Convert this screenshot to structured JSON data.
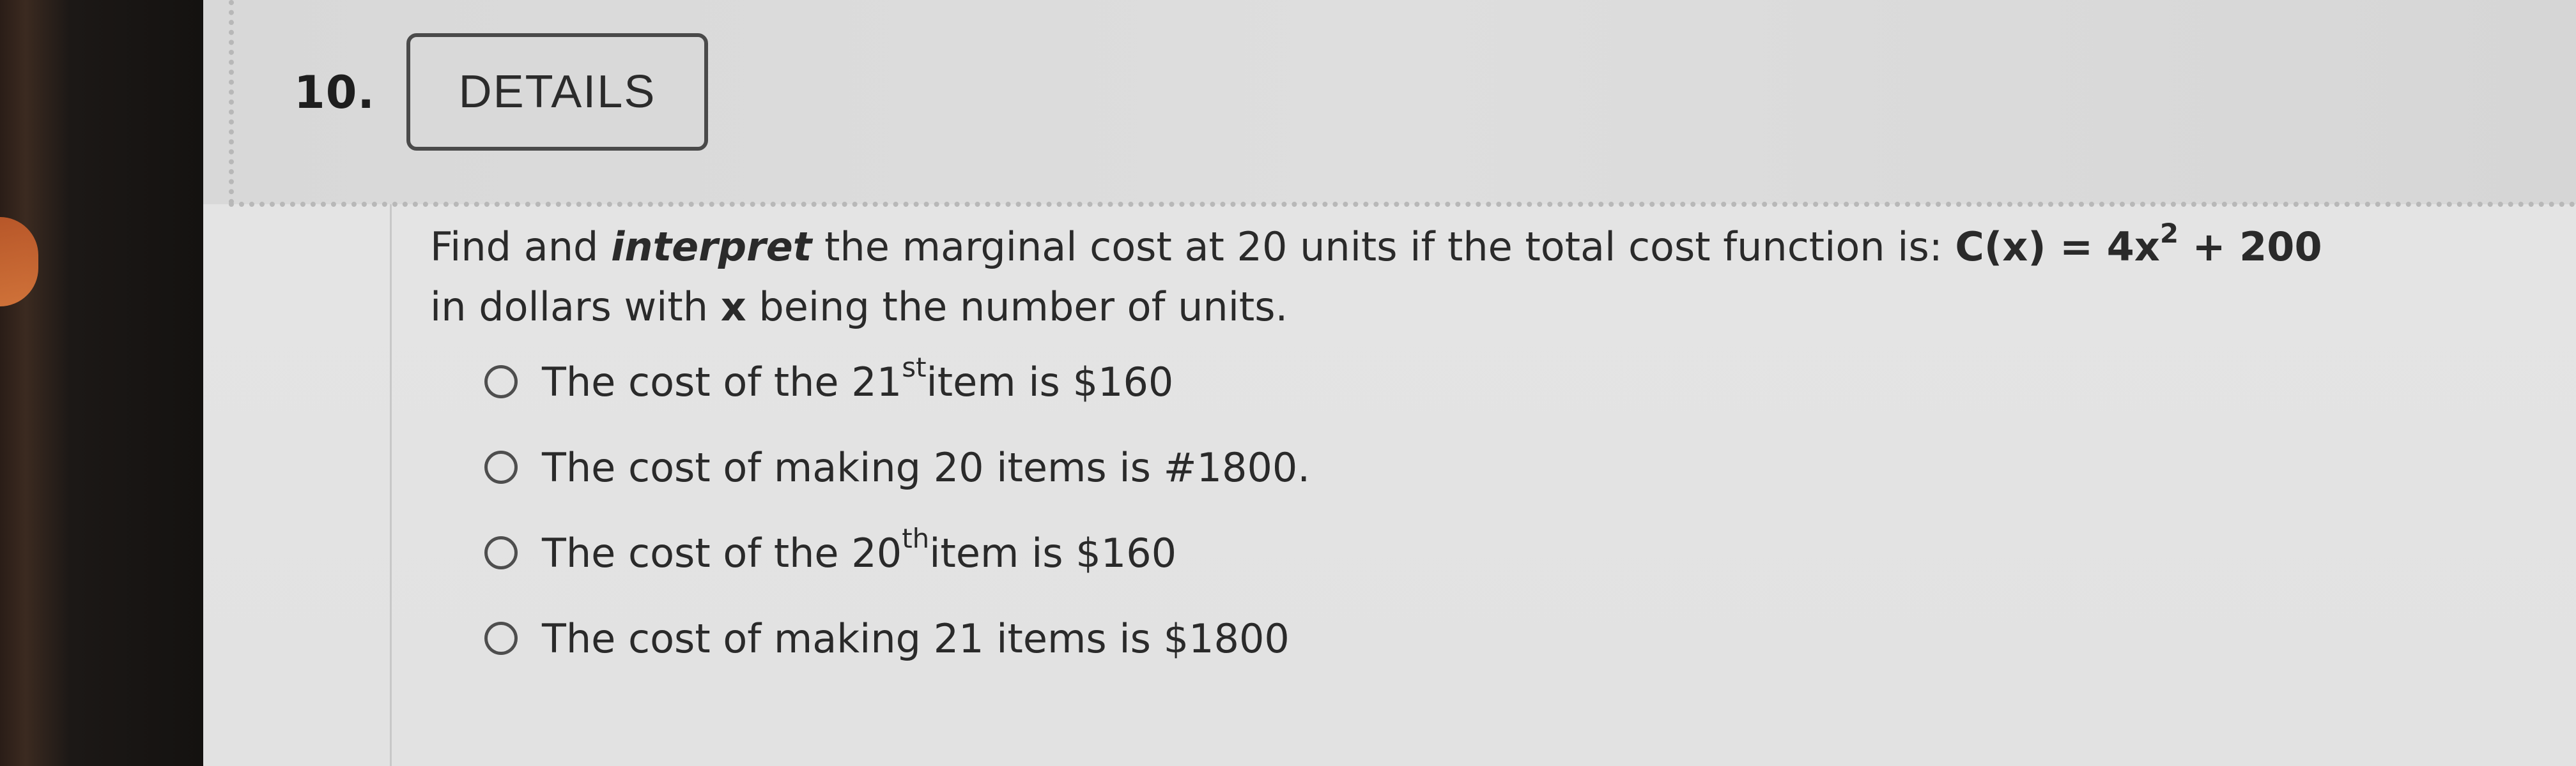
{
  "question": {
    "number": "10.",
    "details_label": "DETAILS",
    "text": {
      "part1": "Find and ",
      "emphasis": "interpret",
      "part2": " the marginal cost at 20 units if the total cost function is: ",
      "formula_lhs": "C(x) = 4x",
      "formula_exp": "2",
      "formula_rhs": " + 200",
      "part3": "in dollars with ",
      "variable": "x",
      "part4": " being the number of units."
    },
    "options": [
      {
        "before": "The cost of the 21",
        "sup": "st",
        "after": "item is $160"
      },
      {
        "before": "The cost of making 20 items is #1800.",
        "sup": "",
        "after": ""
      },
      {
        "before": "The cost of the 20",
        "sup": "th",
        "after": "item is $160"
      },
      {
        "before": "The cost of making 21 items is $1800",
        "sup": "",
        "after": ""
      }
    ]
  },
  "colors": {
    "screen_background": "#e2e2e2",
    "text": "#2a2a2a",
    "button_border": "#4a4a4a",
    "bezel": "#1c1816"
  }
}
